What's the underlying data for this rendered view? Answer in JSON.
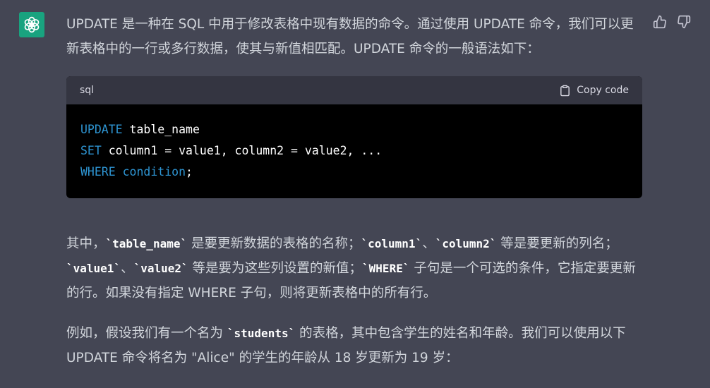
{
  "assistant": {
    "avatar_icon": "openai-logo-icon",
    "avatar_color": "#19a37f"
  },
  "feedback": {
    "thumbs_up_icon": "thumbs-up-icon",
    "thumbs_down_icon": "thumbs-down-icon"
  },
  "message": {
    "intro": "UPDATE 是一种在 SQL 中用于修改表格中现有数据的命令。通过使用 UPDATE 命令，我们可以更新表格中的一行或多行数据，使其与新值相匹配。UPDATE 命令的一般语法如下：",
    "code": {
      "language": "sql",
      "copy_label": "Copy code",
      "copy_icon": "clipboard-icon",
      "line1_kw": "UPDATE",
      "line1_rest": " table_name",
      "line2_kw": "SET",
      "line2_rest": " column1 = value1, column2 = value2, ...",
      "line3_kw": "WHERE",
      "line3_space": " ",
      "line3_cond": "condition",
      "line3_end": ";"
    },
    "explain": {
      "t1": "其中，",
      "c1": "`table_name`",
      "t2": " 是要更新数据的表格的名称；",
      "c2": "`column1`",
      "t3": "、",
      "c3": "`column2`",
      "t4": " 等是要更新的列名；",
      "c4": "`value1`",
      "t5": "、",
      "c5": "`value2`",
      "t6": " 等是要为这些列设置的新值；",
      "c6": "`WHERE`",
      "t7": " 子句是一个可选的条件，它指定要更新的行。如果没有指定 WHERE 子句，则将更新表格中的所有行。"
    },
    "example": {
      "t1": "例如，假设我们有一个名为 ",
      "c1": "`students`",
      "t2": " 的表格，其中包含学生的姓名和年龄。我们可以使用以下 UPDATE 命令将名为 \"Alice\" 的学生的年龄从 18 岁更新为 19 岁："
    }
  },
  "colors": {
    "background": "#444654",
    "code_bg": "#000000",
    "code_header_bg": "#343541",
    "keyword": "#2e95d3",
    "text": "#d1d5db"
  }
}
